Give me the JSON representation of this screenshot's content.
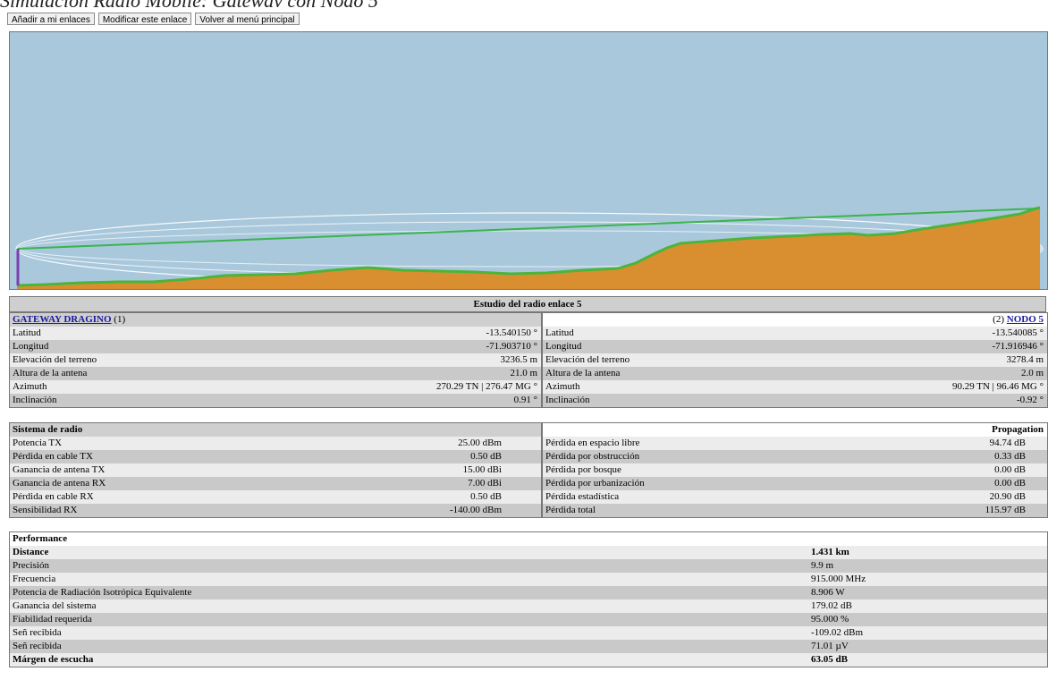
{
  "window_caption": "Simulación Radio Mobile: Gateway con Nodo 5",
  "toolbar": {
    "add_label": "Añadir a mi enlaces",
    "edit_label": "Modificar este enlace",
    "back_label": "Volver al menú principal"
  },
  "colors": {
    "sky": "#a9c8dc",
    "terrain": "#d98f30",
    "vegetation": "#4ab53a",
    "los_line": "#3ab44a",
    "fresnel": "#ffffff",
    "antenna_left": "#7a3fb0"
  },
  "study_title": "Estudio del radio enlace 5",
  "left": {
    "name": "GATEWAY DRAGINO",
    "index": "(1)",
    "rows": [
      {
        "k": "Latitud",
        "v": "-13.540150 °"
      },
      {
        "k": "Longitud",
        "v": "-71.903710 °"
      },
      {
        "k": "Elevación del terreno",
        "v": "3236.5 m"
      },
      {
        "k": "Altura de la antena",
        "v": "21.0 m"
      },
      {
        "k": "Azimuth",
        "v": "270.29 TN | 276.47 MG °"
      },
      {
        "k": "Inclinación",
        "v": "0.91 °"
      }
    ]
  },
  "right": {
    "name": "NODO 5",
    "index": "(2)",
    "rows": [
      {
        "k": "Latitud",
        "v": "-13.540085 °"
      },
      {
        "k": "Longitud",
        "v": "-71.916946 °"
      },
      {
        "k": "Elevación del terreno",
        "v": "3278.4 m"
      },
      {
        "k": "Altura de la antena",
        "v": "2.0 m"
      },
      {
        "k": "Azimuth",
        "v": "90.29 TN | 96.46 MG °"
      },
      {
        "k": "Inclinación",
        "v": "-0.92 °"
      }
    ]
  },
  "radio": {
    "title": "Sistema de radio",
    "rows": [
      {
        "k": "Potencia TX",
        "v": "25.00 dBm"
      },
      {
        "k": "Pérdida en cable TX",
        "v": "0.50 dB"
      },
      {
        "k": "Ganancia de antena TX",
        "v": "15.00 dBi"
      },
      {
        "k": "Ganancia de antena RX",
        "v": "7.00 dBi"
      },
      {
        "k": "Pérdida en cable RX",
        "v": "0.50 dB"
      },
      {
        "k": "Sensibilidad RX",
        "v": "-140.00 dBm"
      }
    ]
  },
  "propagation": {
    "title": "Propagation",
    "rows": [
      {
        "k": "Pérdida en espacio libre",
        "v": "94.74 dB"
      },
      {
        "k": "Pérdida por obstrucción",
        "v": "0.33 dB"
      },
      {
        "k": "Pérdida por bosque",
        "v": "0.00 dB"
      },
      {
        "k": "Pérdida por urbanización",
        "v": "0.00 dB"
      },
      {
        "k": "Pérdida estadística",
        "v": "20.90 dB"
      },
      {
        "k": "Pérdida total",
        "v": "115.97 dB"
      }
    ]
  },
  "performance": {
    "title": "Performance",
    "rows": [
      {
        "k": "Distance",
        "v": "1.431 km",
        "bold": true
      },
      {
        "k": "Precisión",
        "v": "9.9 m"
      },
      {
        "k": "Frecuencia",
        "v": "915.000 MHz"
      },
      {
        "k": "Potencia de Radiación Isotrópica Equivalente",
        "v": "8.906 W"
      },
      {
        "k": "Ganancia del sistema",
        "v": "179.02 dB"
      },
      {
        "k": "Fiabilidad requerida",
        "v": "95.000 %"
      },
      {
        "k": "Señ recibida",
        "v": "-109.02 dBm"
      },
      {
        "k": "Señ recibida",
        "v": "71.01 µV"
      },
      {
        "k": "Márgen de escucha",
        "v": "63.05 dB",
        "bold": true
      }
    ]
  }
}
